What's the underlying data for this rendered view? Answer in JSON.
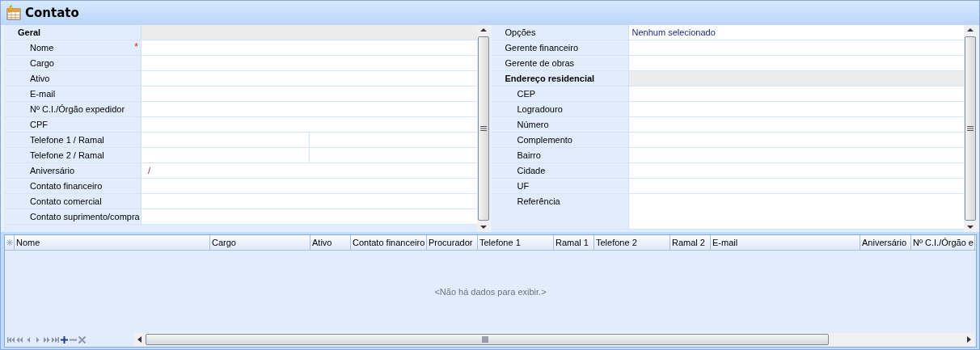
{
  "window": {
    "title": "Contato"
  },
  "left_grid": [
    {
      "kind": "category",
      "label": "Geral",
      "children": [
        {
          "kind": "field",
          "label": "Nome",
          "marker": "*"
        },
        {
          "kind": "field",
          "label": "Cargo"
        },
        {
          "kind": "field",
          "label": "Ativo"
        },
        {
          "kind": "field",
          "label": "E-mail"
        },
        {
          "kind": "field",
          "label": "Nº C.I./Órgão expedidor"
        },
        {
          "kind": "field",
          "label": "CPF"
        },
        {
          "kind": "split",
          "label": "Telefone 1 / Ramal"
        },
        {
          "kind": "split",
          "label": "Telefone 2 / Ramal"
        },
        {
          "kind": "field",
          "label": "Aniversário",
          "value": "/"
        },
        {
          "kind": "field",
          "label": "Contato financeiro"
        },
        {
          "kind": "field",
          "label": "Contato comercial"
        },
        {
          "kind": "field",
          "label": "Contato suprimento/compra"
        }
      ]
    }
  ],
  "right_grid": [
    {
      "kind": "field",
      "label": "Opções",
      "value": "Nenhum selecionado"
    },
    {
      "kind": "field",
      "label": "Gerente financeiro"
    },
    {
      "kind": "field",
      "label": "Gerente de obras"
    },
    {
      "kind": "category",
      "label": "Endereço residencial",
      "children": [
        {
          "kind": "field",
          "label": "CEP"
        },
        {
          "kind": "field",
          "label": "Logradouro"
        },
        {
          "kind": "field",
          "label": "Número"
        },
        {
          "kind": "field",
          "label": "Complemento"
        },
        {
          "kind": "field",
          "label": "Bairro"
        },
        {
          "kind": "field",
          "label": "Cidade"
        },
        {
          "kind": "field",
          "label": "UF"
        },
        {
          "kind": "memo",
          "label": "Referência"
        }
      ]
    }
  ],
  "table": {
    "columns": [
      "Nome",
      "Cargo",
      "Ativo",
      "Contato financeiro",
      "Procurador",
      "Telefone 1",
      "Ramal 1",
      "Telefone 2",
      "Ramal 2",
      "E-mail",
      "Aniversário",
      "Nº C.I./Órgão e"
    ],
    "empty_message": "<Não há dados para exibir.>"
  }
}
